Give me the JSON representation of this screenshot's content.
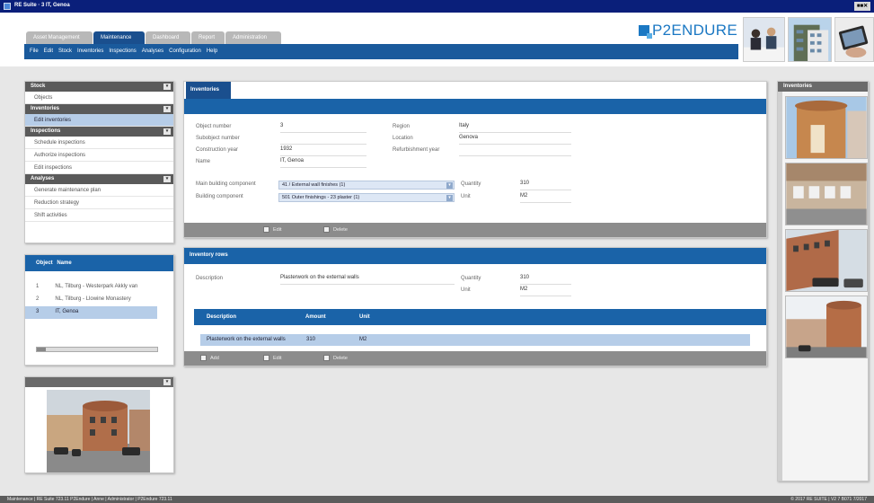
{
  "window": {
    "title": "RE Suite · 3 IT, Genoa",
    "controls": "■■✕"
  },
  "tabs": [
    {
      "label": "Asset Management",
      "active": false
    },
    {
      "label": "Maintenance",
      "active": true
    },
    {
      "label": "Dashboard",
      "active": false
    },
    {
      "label": "Report",
      "active": false
    },
    {
      "label": "Administration",
      "active": false
    }
  ],
  "menu": [
    "File",
    "Edit",
    "Stock",
    "Inventories",
    "Inspections",
    "Analyses",
    "Configuration",
    "Help"
  ],
  "logo": {
    "text": "P2ENDURE",
    "icon": "p2endure-logo-icon"
  },
  "sidebar": {
    "stock": {
      "title": "Stock",
      "items": [
        "Objects"
      ]
    },
    "inventories": {
      "title": "Inventories",
      "items": [
        "Edit inventories"
      ],
      "selected": 0
    },
    "inspections": {
      "title": "Inspections",
      "items": [
        "Schedule inspections",
        "Authorize inspections",
        "Edit inspections"
      ]
    },
    "analyses": {
      "title": "Analyses",
      "items": [
        "Generate maintenance plan",
        "Reduction strategy",
        "Shift activities"
      ]
    }
  },
  "object_list": {
    "header_object": "Object",
    "header_name": "Name",
    "rows": [
      {
        "num": "1",
        "name": "NL, Tilburg - Westerpark Akkly van"
      },
      {
        "num": "2",
        "name": "NL, Tilburg - Llowine Monastery"
      },
      {
        "num": "3",
        "name": "IT, Genoa"
      }
    ],
    "selected": 2
  },
  "inventories": {
    "tab": "Inventories",
    "labels": {
      "object_number": "Object number",
      "subobject_number": "Subobject number",
      "construction_year": "Construction year",
      "name": "Name",
      "region": "Region",
      "location": "Location",
      "refurbishment_year": "Refurbishment year",
      "main_building_component": "Main building component",
      "building_component": "Building component",
      "quantity": "Quantity",
      "unit": "Unit"
    },
    "values": {
      "object_number": "3",
      "subobject_number": "",
      "construction_year": "1932",
      "name": "IT, Genoa",
      "region": "Italy",
      "location": "Genova",
      "refurbishment_year": "",
      "main_building_component": "41 / External wall finishes (1)",
      "building_component": "501 Outer finishings - 23 plaster (1)",
      "quantity": "310",
      "unit": "M2"
    },
    "actions": {
      "edit": "Edit",
      "delete": "Delete"
    }
  },
  "inventory_rows": {
    "title": "Inventory rows",
    "labels": {
      "description": "Description",
      "quantity": "Quantity",
      "unit": "Unit"
    },
    "values": {
      "description": "Plasterwork on the external walls",
      "quantity": "310",
      "unit": "M2"
    },
    "table": {
      "headers": [
        "Description",
        "Amount",
        "Unit"
      ],
      "rows": [
        [
          "Plasterwork on the external walls",
          "310",
          "M2"
        ]
      ]
    },
    "actions": {
      "add": "Add",
      "edit": "Edit",
      "delete": "Delete"
    }
  },
  "thumbnails": {
    "title": "Inventories"
  },
  "status": {
    "left": "Maintenance | RE Suite 723.11 P2Endure | Anne | Administrator | P2Endure 723.11",
    "right": "© 2017 RE SUITE | V2 7 B071 7/2017"
  }
}
